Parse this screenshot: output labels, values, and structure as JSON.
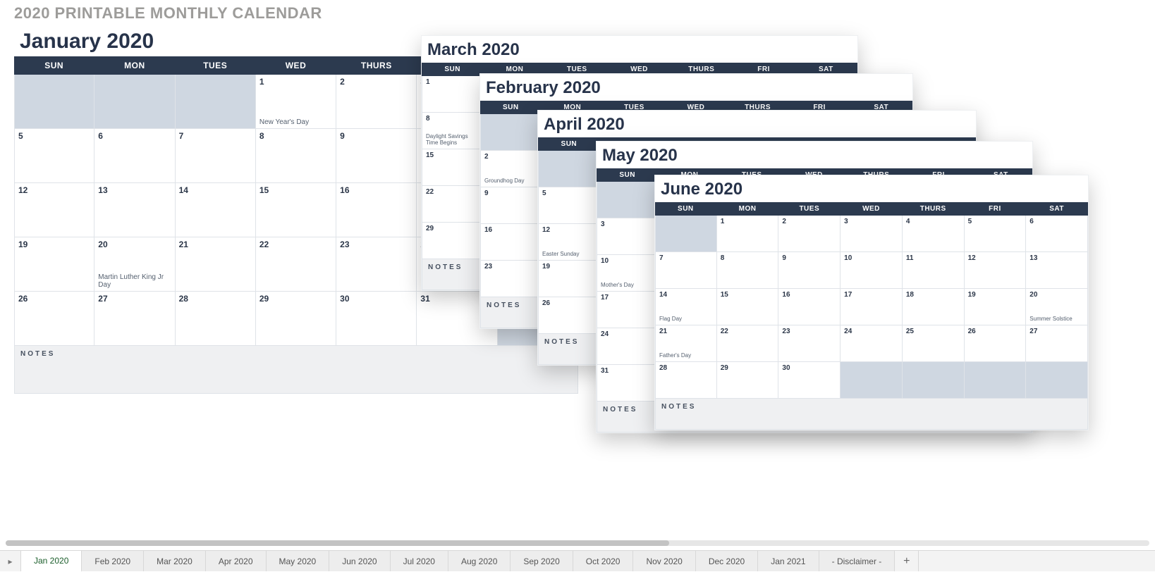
{
  "title": "2020 PRINTABLE MONTHLY CALENDAR",
  "weekday_labels": [
    "SUN",
    "MON",
    "TUES",
    "WED",
    "THURS",
    "FRI",
    "SAT"
  ],
  "notes_label": "NOTES",
  "months": {
    "jan": {
      "name": "January 2020",
      "start_pad": 3,
      "days": 31,
      "events": {
        "1": "New Year's Day",
        "20": "Martin Luther King Jr Day"
      }
    },
    "feb": {
      "name": "February 2020",
      "start_pad": 6,
      "days": 29,
      "events": {
        "2": "Groundhog Day"
      }
    },
    "mar": {
      "name": "March 2020",
      "start_pad": 0,
      "days": 31,
      "events": {
        "8": "Daylight Savings Time Begins"
      }
    },
    "apr": {
      "name": "April 2020",
      "start_pad": 3,
      "days": 30,
      "events": {
        "12": "Easter Sunday"
      }
    },
    "may": {
      "name": "May 2020",
      "start_pad": 5,
      "days": 31,
      "events": {
        "10": "Mother's Day"
      }
    },
    "jun": {
      "name": "June 2020",
      "start_pad": 1,
      "days": 30,
      "events": {
        "14": "Flag Day",
        "20": "Summer Solstice",
        "21": "Father's Day"
      }
    }
  },
  "tabs": {
    "active": "Jan 2020",
    "items": [
      "Jan 2020",
      "Feb 2020",
      "Mar 2020",
      "Apr 2020",
      "May 2020",
      "Jun 2020",
      "Jul 2020",
      "Aug 2020",
      "Sep 2020",
      "Oct 2020",
      "Nov 2020",
      "Dec 2020",
      "Jan 2021",
      "- Disclaimer -"
    ]
  }
}
